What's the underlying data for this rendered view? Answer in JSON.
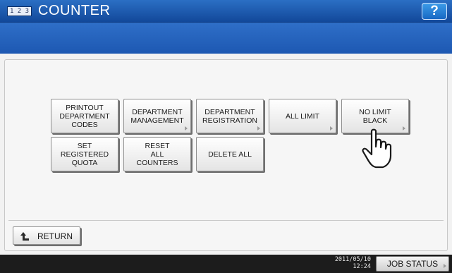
{
  "title": {
    "icon_text": "1 2 3",
    "text": "COUNTER"
  },
  "help_label": "?",
  "buttons": [
    {
      "id": "printout-department-codes-button",
      "label": "PRINTOUT\nDEPARTMENT\nCODES",
      "arrow": false
    },
    {
      "id": "department-management-button",
      "label": "DEPARTMENT\nMANAGEMENT",
      "arrow": true
    },
    {
      "id": "department-registration-button",
      "label": "DEPARTMENT\nREGISTRATION",
      "arrow": true
    },
    {
      "id": "all-limit-button",
      "label": "ALL LIMIT",
      "arrow": true
    },
    {
      "id": "no-limit-black-button",
      "label": "NO LIMIT\nBLACK",
      "arrow": true
    },
    {
      "id": "set-registered-quota-button",
      "label": "SET\nREGISTERED\nQUOTA",
      "arrow": false
    },
    {
      "id": "reset-all-counters-button",
      "label": "RESET\nALL\nCOUNTERS",
      "arrow": false
    },
    {
      "id": "delete-all-button",
      "label": "DELETE ALL",
      "arrow": false
    }
  ],
  "return_label": "RETURN",
  "status": {
    "date": "2011/05/10",
    "time": "12:24",
    "job_status_label": "JOB STATUS"
  },
  "colors": {
    "titlebar": "#1a56ad",
    "statusbar": "#1c1c1c",
    "help": "#1f7ad6"
  }
}
